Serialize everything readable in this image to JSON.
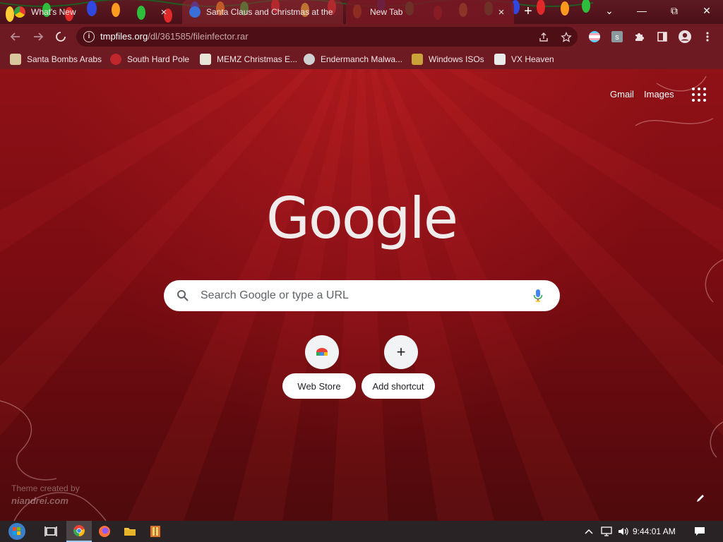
{
  "tabs": [
    {
      "title": "What's New",
      "favicon": "chrome-icon",
      "close": "×"
    },
    {
      "title": "Santa Claus and Christmas at the",
      "favicon": "site-favicon",
      "close": ""
    },
    {
      "title": "New Tab",
      "favicon": "new-tab-icon",
      "close": "×"
    }
  ],
  "newtab_label": "+",
  "window_controls": {
    "search_tabs": "⌄",
    "minimize": "—",
    "restore": "⧉",
    "close": "✕"
  },
  "omnibox": {
    "host": "tmpfiles.org",
    "path": "/dl/361585/fileinfector.rar",
    "info": "i"
  },
  "bookmarks": [
    {
      "label": "Santa Bombs Arabs",
      "icon": "santa-bookmark-icon",
      "color": "#d9c7a0"
    },
    {
      "label": "South Hard Pole",
      "icon": "snowflake-bookmark-icon",
      "color": "#c0272d"
    },
    {
      "label": "MEMZ Christmas E...",
      "icon": "memz-bookmark-icon",
      "color": "#e8e4d8"
    },
    {
      "label": "Endermanch Malwa...",
      "icon": "endermanch-bookmark-icon",
      "color": "#d0d0d0"
    },
    {
      "label": "Windows ISOs",
      "icon": "windows-iso-bookmark-icon",
      "color": "#c9a23a"
    },
    {
      "label": "VX Heaven",
      "icon": "vx-heaven-bookmark-icon",
      "color": "#eaeaea"
    }
  ],
  "header_links": {
    "gmail": "Gmail",
    "images": "Images"
  },
  "logo_text": "Google",
  "search": {
    "placeholder": "Search Google or type a URL"
  },
  "shortcuts": [
    {
      "label": "Web Store",
      "icon": "web-store-icon"
    },
    {
      "label": "Add shortcut",
      "icon": "plus-icon",
      "glyph": "+"
    }
  ],
  "theme_credit": {
    "line1": "Theme created by",
    "line2": "niandrei.com"
  },
  "taskbar": {
    "clock": "9:44:01 AM"
  },
  "colors": {
    "accent": "#8f1116",
    "chrome_frame": "#6e1a22",
    "omnibox": "#4d0e15",
    "taskbar": "#2a2326"
  }
}
